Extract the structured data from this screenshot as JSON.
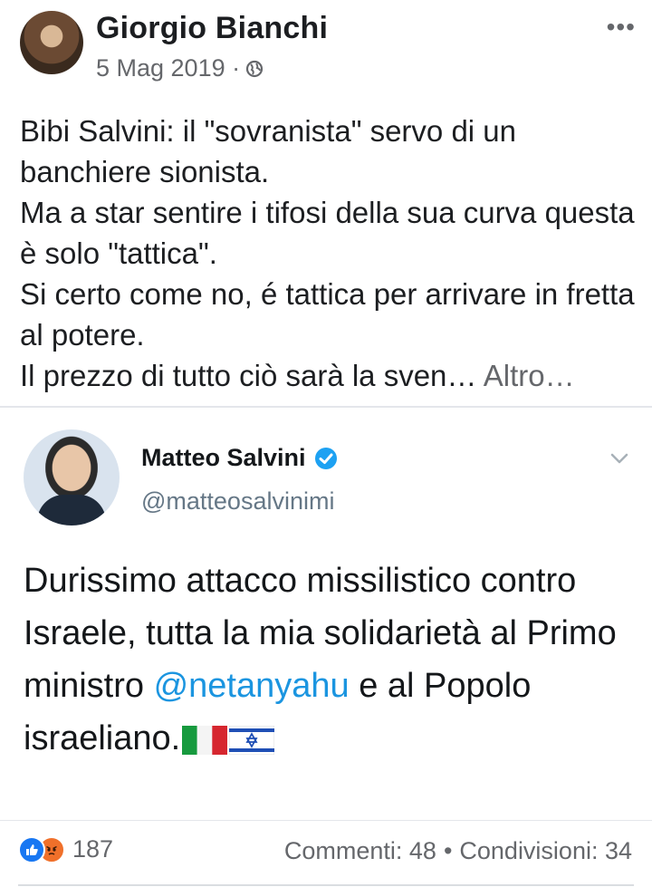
{
  "post": {
    "author": "Giorgio Bianchi",
    "date": "5 Mag 2019 ·",
    "text": "Bibi Salvini: il \"sovranista\" servo di un banchiere sionista.\nMa a star sentire i tifosi della sua curva questa è solo \"tattica\".\nSi certo come no, é tattica per arrivare in fretta al potere.\nIl prezzo di tutto ciò sarà la sven… ",
    "see_more": "Altro…",
    "more_icon": "more-horizontal-icon",
    "privacy_icon": "globe-icon"
  },
  "tweet": {
    "name": "Matteo Salvini",
    "handle": "@matteosalvinimi",
    "text_before": "Durissimo attacco missilistico contro Israele, tutta la mia solidarietà al Primo ministro ",
    "mention": "@netanyahu",
    "text_after": " e al Popolo israeliano.",
    "flags": [
      "italy-flag-icon",
      "israel-flag-icon"
    ],
    "mention_color": "#1b95e0",
    "verified_color": "#1da1f2"
  },
  "footer": {
    "reaction_count": "187",
    "comments": "Commenti: 48",
    "separator": "•",
    "shares": "Condivisioni: 34",
    "like_color": "#1877f2",
    "angry_color": "#f0702a"
  }
}
